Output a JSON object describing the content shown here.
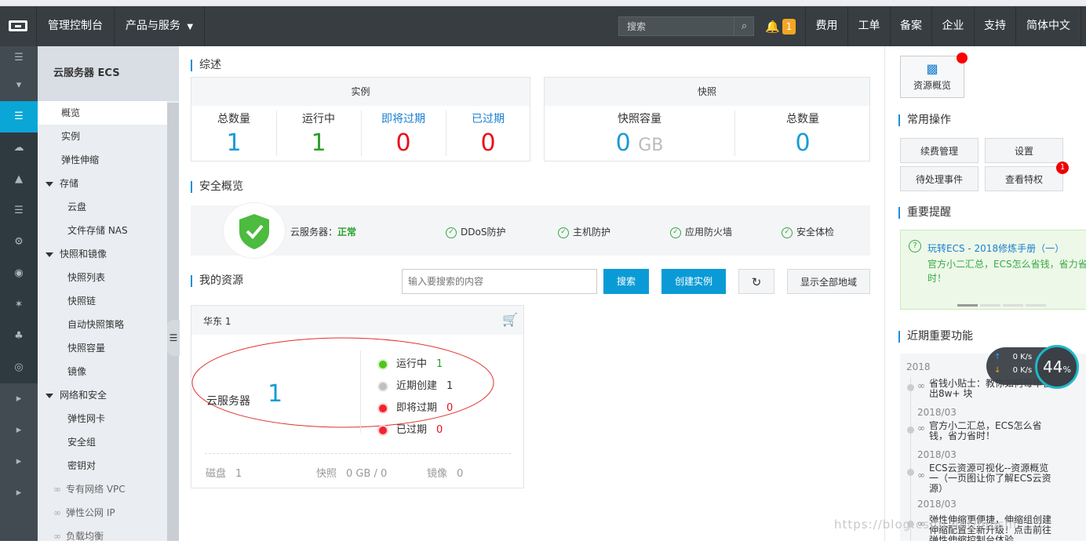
{
  "topnav": {
    "console": "管理控制台",
    "products": "产品与服务",
    "search_placeholder": "搜索",
    "notification_count": "1",
    "items": [
      "费用",
      "工单",
      "备案",
      "企业",
      "支持",
      "简体中文"
    ]
  },
  "sidebar": {
    "title": "云服务器 ECS",
    "items": [
      {
        "label": "概览"
      },
      {
        "label": "实例"
      },
      {
        "label": "弹性伸缩"
      },
      {
        "label": "存储"
      },
      {
        "label": "云盘"
      },
      {
        "label": "文件存储 NAS"
      },
      {
        "label": "快照和镜像"
      },
      {
        "label": "快照列表"
      },
      {
        "label": "快照链"
      },
      {
        "label": "自动快照策略"
      },
      {
        "label": "快照容量"
      },
      {
        "label": "镜像"
      },
      {
        "label": "网络和安全"
      },
      {
        "label": "弹性网卡"
      },
      {
        "label": "安全组"
      },
      {
        "label": "密钥对"
      },
      {
        "label": "专有网络 VPC"
      },
      {
        "label": "弹性公网 IP"
      },
      {
        "label": "负载均衡"
      }
    ]
  },
  "overview": {
    "title": "综述",
    "instances": {
      "header": "实例",
      "stats": [
        {
          "label": "总数量",
          "value": "1"
        },
        {
          "label": "运行中",
          "value": "1"
        },
        {
          "label": "即将过期",
          "value": "0"
        },
        {
          "label": "已过期",
          "value": "0"
        }
      ]
    },
    "snapshots": {
      "header": "快照",
      "capacity_label": "快照容量",
      "capacity_value": "0",
      "capacity_unit": "GB",
      "total_label": "总数量",
      "total_value": "0"
    }
  },
  "security": {
    "title": "安全概览",
    "server_label": "云服务器：",
    "server_status": "正常",
    "checks": [
      "DDoS防护",
      "主机防护",
      "应用防火墙",
      "安全体检"
    ]
  },
  "resources": {
    "title": "我的资源",
    "search_placeholder": "输入要搜索的内容",
    "search_btn": "搜索",
    "create_btn": "创建实例",
    "show_all_btn": "显示全部地域",
    "region_card": {
      "region": "华东 1",
      "server_label": "云服务器",
      "server_count": "1",
      "statuses": [
        {
          "label": "运行中",
          "value": "1",
          "color": "#52c41a"
        },
        {
          "label": "近期创建",
          "value": "1",
          "color": "#bfbfbf"
        },
        {
          "label": "即将过期",
          "value": "0",
          "color": "#f5222d"
        },
        {
          "label": "已过期",
          "value": "0",
          "color": "#f5222d"
        }
      ],
      "disk_label": "磁盘",
      "disk_value": "1",
      "snapshot_label": "快照",
      "snapshot_value": "0 GB / 0",
      "image_label": "镜像",
      "image_value": "0"
    }
  },
  "right": {
    "resource_overview": "资源概览",
    "common_ops_title": "常用操作",
    "ops": [
      "续费管理",
      "设置",
      "待处理事件",
      "查看特权"
    ],
    "ops_badge": "1",
    "reminder_title": "重要提醒",
    "reminder_link": "玩转ECS - 2018修炼手册（一）",
    "reminder_text": "官方小二汇总，ECS怎么省钱，省力省时！",
    "recent_title": "近期重要功能",
    "recent_year": "2018",
    "recent_items": [
      {
        "text": "省钱小贴士：教你如何每年省出8w+ 块",
        "date": "2018/03"
      },
      {
        "text": "官方小二汇总，ECS怎么省钱，省力省时！",
        "date": "2018/03"
      },
      {
        "text": "ECS云资源可视化--资源概览一（一页图让你了解ECS云资源）",
        "date": "2018/03"
      },
      {
        "text": "弹性伸缩更便捷，伸缩组创建伸缩配置全新升级！点击前往弹性伸缩控制台体验",
        "date": ""
      }
    ]
  },
  "speed_widget": {
    "up": "0 K/s",
    "down": "0 K/s",
    "percent": "44",
    "percent_unit": "%"
  },
  "watermark": "https://blog.csdn.net/musm"
}
